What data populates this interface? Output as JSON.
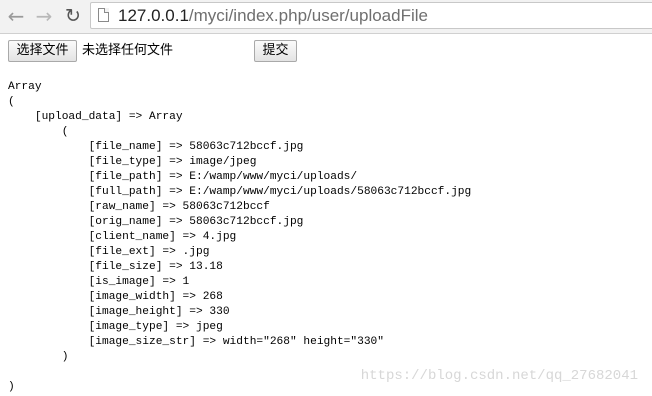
{
  "browser": {
    "url_host": "127.0.0.1",
    "url_path": "/myci/index.php/user/uploadFile",
    "back_icon": "arrow-left-icon",
    "forward_icon": "arrow-right-icon",
    "reload_icon": "reload-icon",
    "page_icon": "page-icon"
  },
  "form": {
    "choose_label": "选择文件",
    "no_file_text": "未选择任何文件",
    "submit_label": "提交"
  },
  "output": {
    "lines": [
      "Array",
      "(",
      "    [upload_data] => Array",
      "        (",
      "            [file_name] => 58063c712bccf.jpg",
      "            [file_type] => image/jpeg",
      "            [file_path] => E:/wamp/www/myci/uploads/",
      "            [full_path] => E:/wamp/www/myci/uploads/58063c712bccf.jpg",
      "            [raw_name] => 58063c712bccf",
      "            [orig_name] => 58063c712bccf.jpg",
      "            [client_name] => 4.jpg",
      "            [file_ext] => .jpg",
      "            [file_size] => 13.18",
      "            [is_image] => 1",
      "            [image_width] => 268",
      "            [image_height] => 330",
      "            [image_type] => jpeg",
      "            [image_size_str] => width=\"268\" height=\"330\"",
      "        )",
      "",
      ")"
    ]
  },
  "watermark": "https://blog.csdn.net/qq_27682041"
}
